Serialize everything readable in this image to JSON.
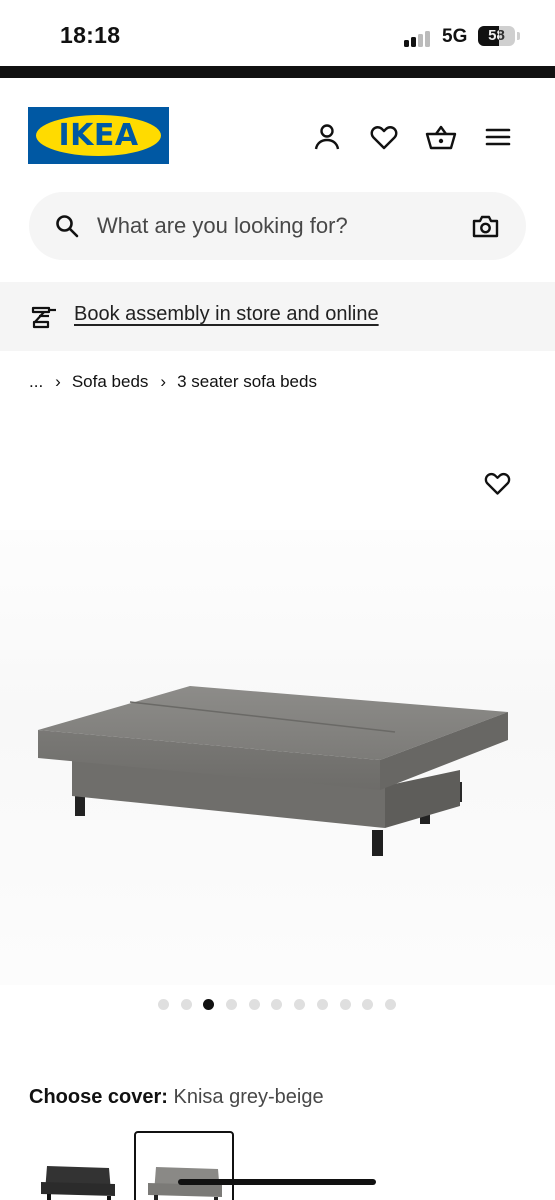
{
  "status_bar": {
    "time": "18:18",
    "network": "5G",
    "battery_percent": "58",
    "battery_level": 0.58,
    "signal_bars_active": 2,
    "signal_bars_total": 4
  },
  "header": {
    "logo_text": "IKEA",
    "brand_colors": {
      "blue": "#0058a3",
      "yellow": "#ffdb00"
    },
    "icons": [
      "profile-icon",
      "heart-icon",
      "shopping-basket-icon",
      "hamburger-menu-icon"
    ]
  },
  "search": {
    "placeholder": "What are you looking for?",
    "value": "",
    "icons": [
      "search-icon",
      "camera-icon"
    ]
  },
  "promo": {
    "icon": "assembly-tool-icon",
    "link_text": "Book assembly in store and online"
  },
  "breadcrumb": {
    "items": [
      "...",
      "Sofa beds",
      "3 seater sofa beds"
    ],
    "separator": "›"
  },
  "gallery": {
    "image_count": 11,
    "active_index": 3,
    "favorite_icon": "heart-icon"
  },
  "cover": {
    "label": "Choose cover:",
    "value": "Knisa grey-beige",
    "swatches": [
      {
        "name": "dark-grey",
        "selected": false
      },
      {
        "name": "grey-beige",
        "selected": true
      }
    ]
  }
}
